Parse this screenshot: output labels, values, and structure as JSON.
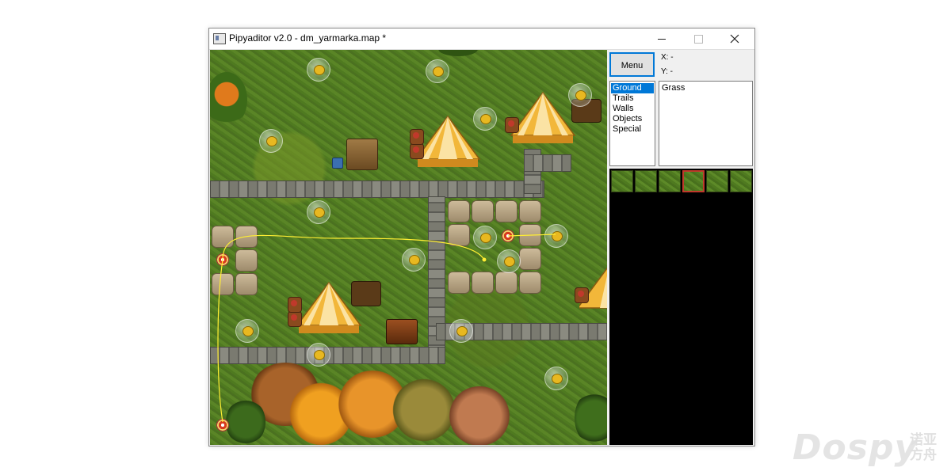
{
  "window": {
    "title": "Pipyaditor v2.0 - dm_yarmarka.map *",
    "controls": {
      "minimize": "minimize",
      "maximize": "maximize",
      "close": "close"
    }
  },
  "panel": {
    "menu_label": "Menu",
    "coord_x": "X: -",
    "coord_y": "Y: -",
    "categories": [
      "Ground",
      "Trails",
      "Walls",
      "Objects",
      "Special"
    ],
    "selected_category": "Ground",
    "types": [
      "Grass"
    ],
    "palette_tile_count": 6,
    "selected_tile_index": 3
  },
  "watermark": {
    "text": "Dospy",
    "cn": "诺亚方舟"
  },
  "colors": {
    "accent": "#0078d7",
    "grass": "#4f7a20",
    "selection_border": "#c0392b",
    "palette_bg": "#000000"
  },
  "icons": {
    "app": "app-icon",
    "minimize": "minimize-icon",
    "maximize": "maximize-icon",
    "close": "close-icon"
  }
}
